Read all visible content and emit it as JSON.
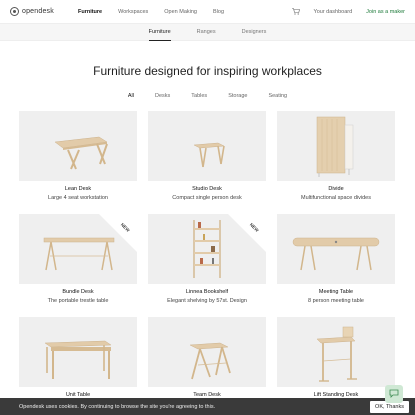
{
  "brand": {
    "name": "opendesk"
  },
  "nav": {
    "items": [
      "Furniture",
      "Workspaces",
      "Open Making",
      "Blog"
    ],
    "active": 0
  },
  "account": {
    "dashboard": "Your dashboard",
    "join": "Join as a maker"
  },
  "subnav": {
    "items": [
      "Furniture",
      "Ranges",
      "Designers"
    ],
    "active": 0
  },
  "headline": "Furniture designed for inspiring workplaces",
  "filters": {
    "items": [
      "All",
      "Desks",
      "Tables",
      "Storage",
      "Seating"
    ],
    "active": 0
  },
  "products": [
    {
      "name": "Lean Desk",
      "desc": "Large 4 seat workstation",
      "badge": ""
    },
    {
      "name": "Studio Desk",
      "desc": "Compact single person desk",
      "badge": ""
    },
    {
      "name": "Divide",
      "desc": "Multifunctional space divides",
      "badge": ""
    },
    {
      "name": "Bundle Desk",
      "desc": "The portable trestle table",
      "badge": "NEW"
    },
    {
      "name": "Linnea Bookshelf",
      "desc": "Elegant shelving by 57st. Design",
      "badge": "NEW"
    },
    {
      "name": "Meeting Table",
      "desc": "8 person meeting table",
      "badge": ""
    },
    {
      "name": "Unit Table",
      "desc": "",
      "badge": ""
    },
    {
      "name": "Team Desk",
      "desc": "",
      "badge": ""
    },
    {
      "name": "Lift Standing Desk",
      "desc": "",
      "badge": ""
    }
  ],
  "cookie": {
    "text": "Opendesk uses cookies. By continuing to browse the site you're agreeing to this.",
    "button": "OK, Thanks"
  },
  "colors": {
    "accent": "#1d7a3a",
    "wood": "#e2cba9",
    "card_bg": "#efefef"
  },
  "icons": {
    "cart": "cart-icon",
    "chat": "chat-icon",
    "logo": "logo-icon"
  }
}
